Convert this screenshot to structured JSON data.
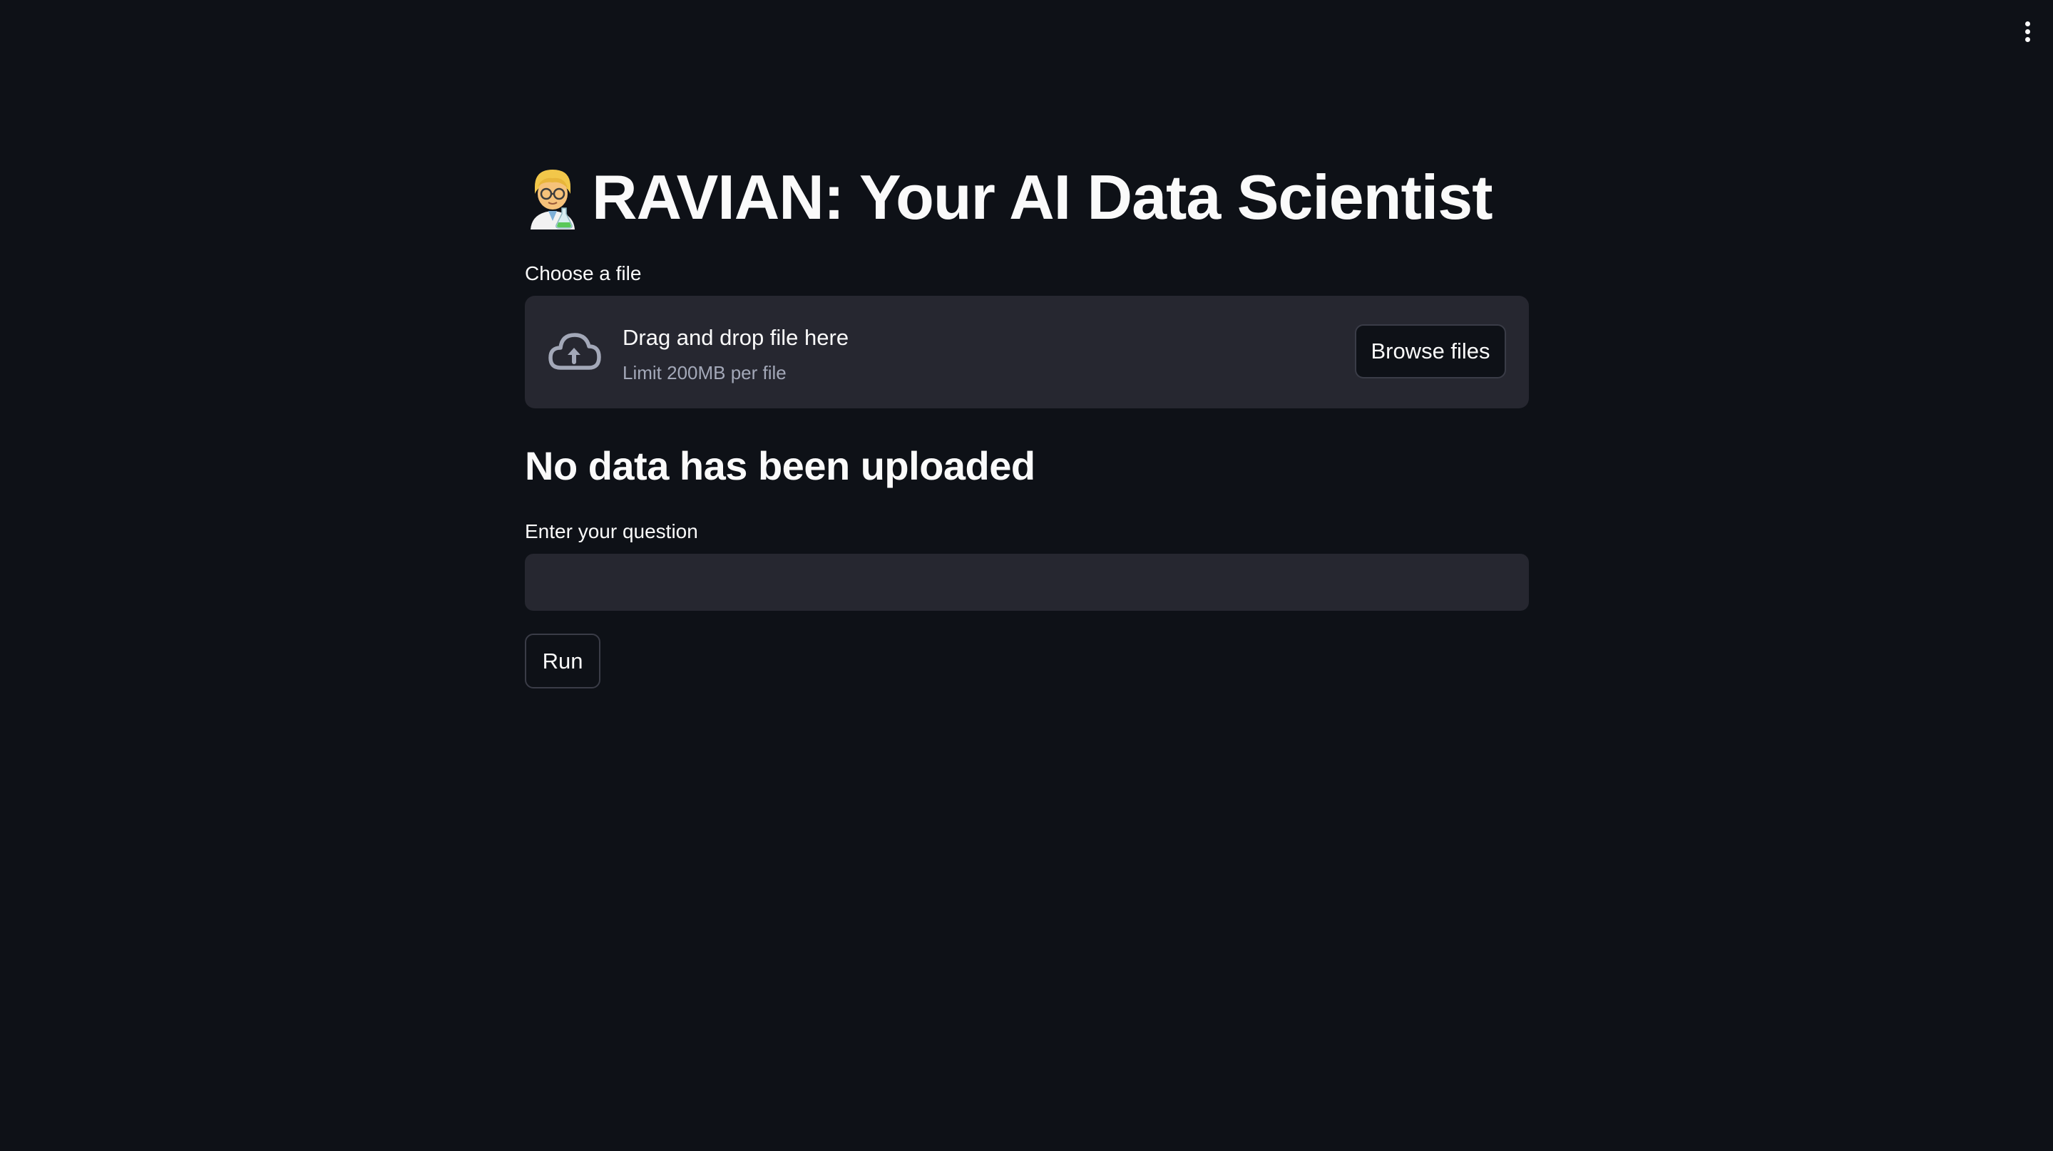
{
  "app": {
    "title_emoji_icon": "scientist-emoji",
    "title": "RAVIAN: Your AI Data Scientist",
    "menu_icon": "kebab-menu-icon"
  },
  "uploader": {
    "label": "Choose a file",
    "icon": "cloud-upload-icon",
    "drop_text": "Drag and drop file here",
    "limit_text": "Limit 200MB per file",
    "browse_label": "Browse files"
  },
  "status": {
    "heading": "No data has been uploaded"
  },
  "question": {
    "label": "Enter your question",
    "value": "",
    "placeholder": ""
  },
  "actions": {
    "run_label": "Run"
  },
  "colors": {
    "background": "#0e1117",
    "surface": "#262730",
    "text": "#fafafa",
    "muted_text": "#a3a8b8",
    "border": "#3a3c47"
  }
}
